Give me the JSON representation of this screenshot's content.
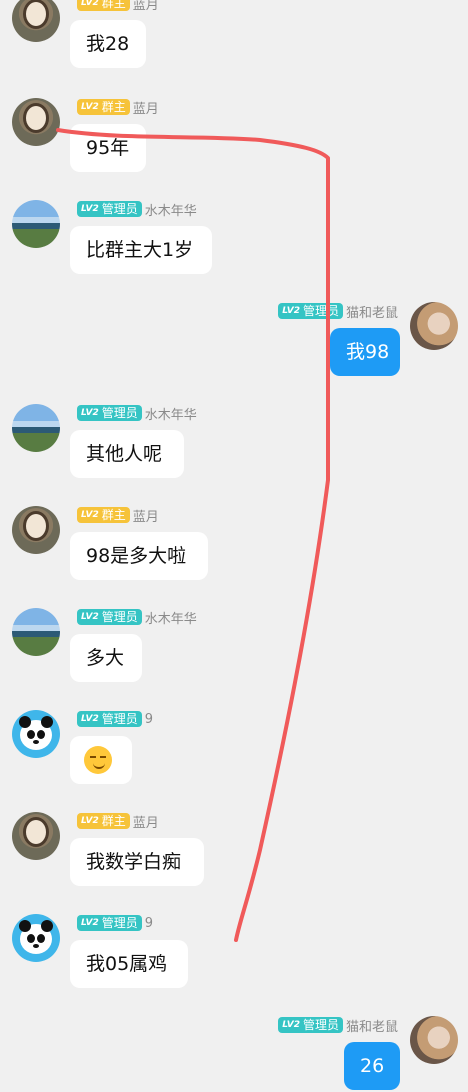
{
  "messages": [
    {
      "side": "left",
      "avatar": "lanyue",
      "level": "LV2",
      "role": "群主",
      "role_type": "owner",
      "name": "蓝月",
      "text": "我28"
    },
    {
      "side": "left",
      "avatar": "lanyue",
      "level": "LV2",
      "role": "群主",
      "role_type": "owner",
      "name": "蓝月",
      "text": "95年"
    },
    {
      "side": "left",
      "avatar": "landscape",
      "level": "LV2",
      "role": "管理员",
      "role_type": "admin",
      "name": "水木年华",
      "text": "比群主大1岁"
    },
    {
      "side": "right",
      "avatar": "catmouse",
      "level": "LV2",
      "role": "管理员",
      "role_type": "admin",
      "name": "猫和老鼠",
      "text": "我98"
    },
    {
      "side": "left",
      "avatar": "landscape",
      "level": "LV2",
      "role": "管理员",
      "role_type": "admin",
      "name": "水木年华",
      "text": "其他人呢"
    },
    {
      "side": "left",
      "avatar": "lanyue",
      "level": "LV2",
      "role": "群主",
      "role_type": "owner",
      "name": "蓝月",
      "text": "98是多大啦"
    },
    {
      "side": "left",
      "avatar": "landscape",
      "level": "LV2",
      "role": "管理员",
      "role_type": "admin",
      "name": "水木年华",
      "text": "多大"
    },
    {
      "side": "left",
      "avatar": "panda",
      "level": "LV2",
      "role": "管理员",
      "role_type": "admin",
      "name": "9",
      "emoji": "smirk-emoji"
    },
    {
      "side": "left",
      "avatar": "lanyue",
      "level": "LV2",
      "role": "群主",
      "role_type": "owner",
      "name": "蓝月",
      "text": "我数学白痴"
    },
    {
      "side": "left",
      "avatar": "panda",
      "level": "LV2",
      "role": "管理员",
      "role_type": "admin",
      "name": "9",
      "text": "我05属鸡"
    },
    {
      "side": "right",
      "avatar": "catmouse",
      "level": "LV2",
      "role": "管理员",
      "role_type": "admin",
      "name": "猫和老鼠",
      "text": "26"
    }
  ],
  "colors": {
    "background": "#f0f0f0",
    "owner_badge": "#f6c33a",
    "admin_badge": "#35c4c4",
    "self_bubble": "#1e9bf5",
    "scribble": "#f05a5a"
  }
}
